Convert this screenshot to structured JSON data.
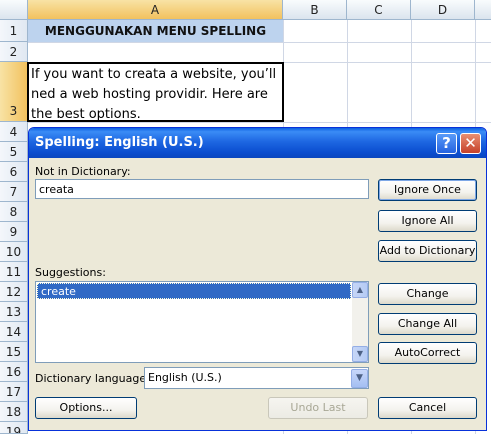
{
  "sheet": {
    "columns": [
      "A",
      "B",
      "C",
      "D"
    ],
    "rows": [
      "1",
      "2",
      "3",
      "4",
      "5",
      "6",
      "7",
      "8",
      "9",
      "10",
      "11",
      "12",
      "13",
      "14",
      "15",
      "16",
      "17",
      "18",
      "19"
    ],
    "title_cell": "MENGGUNAKAN MENU SPELLING",
    "active_cell_text": "If you want to creata a website, you’ll ned a web hosting providir. Here are the best options."
  },
  "dialog": {
    "title": "Spelling: English (U.S.)",
    "help_glyph": "?",
    "close_glyph": "✕",
    "not_in_dictionary_label": "Not in Dictionary:",
    "not_in_dictionary_value": "creata",
    "suggestions_label": "Suggestions:",
    "suggestions": [
      "create"
    ],
    "dictionary_language_label": "Dictionary language:",
    "dictionary_language_value": "English (U.S.)",
    "buttons": {
      "ignore_once": "Ignore Once",
      "ignore_all": "Ignore All",
      "add_to_dictionary": "Add to Dictionary",
      "change": "Change",
      "change_all": "Change All",
      "autocorrect": "AutoCorrect",
      "options": "Options...",
      "undo_last": "Undo Last",
      "cancel": "Cancel"
    }
  },
  "colors": {
    "title_fill": "#bdd3ee",
    "dialog_face": "#ece9d8",
    "titlebar_blue": "#0b4ed0",
    "selection_blue": "#316ac5"
  }
}
